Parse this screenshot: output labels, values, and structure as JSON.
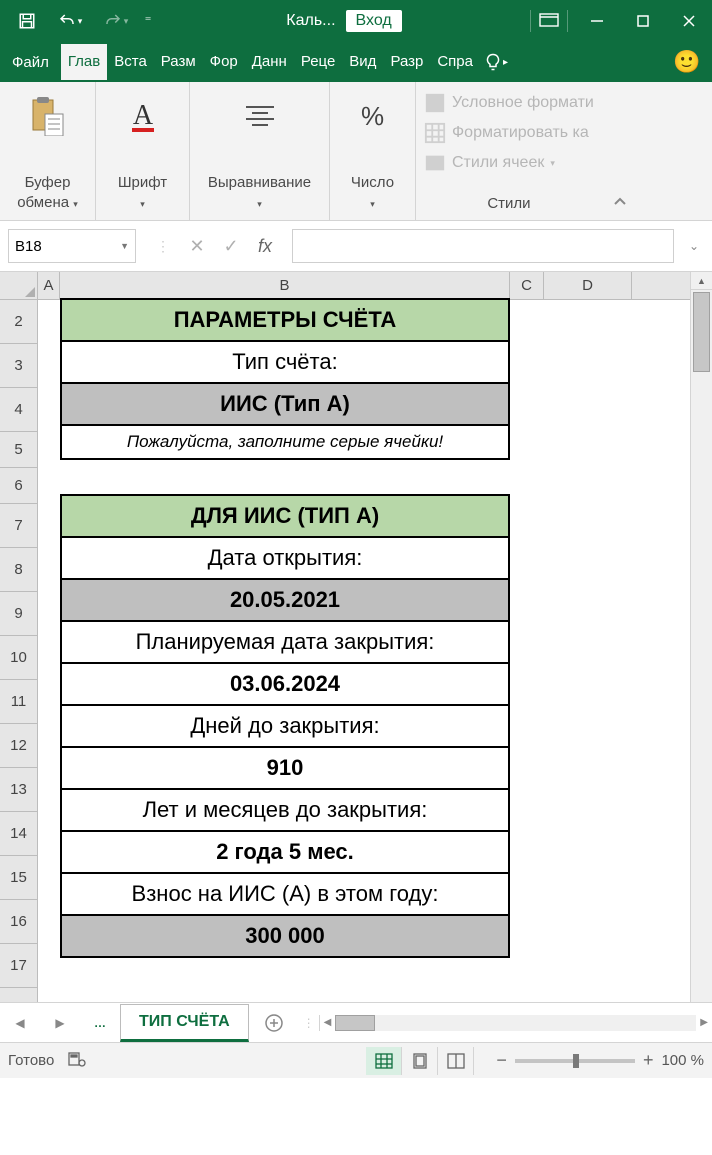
{
  "titlebar": {
    "doc_name": "Каль...",
    "signin": "Вход"
  },
  "tabs": {
    "file": "Файл",
    "items": [
      "Глав",
      "Вста",
      "Разм",
      "Фор",
      "Данн",
      "Реце",
      "Вид",
      "Разр",
      "Спра"
    ]
  },
  "ribbon": {
    "clipboard": "Буфер\nобмена",
    "font": "Шрифт",
    "align": "Выравнивание",
    "number": "Число",
    "pct": "%",
    "cond_format": "Условное формати",
    "format_as": "Форматировать ка",
    "cell_styles": "Стили ячеек",
    "styles_label": "Стили"
  },
  "namebox": "B18",
  "fx": "fx",
  "columns": {
    "A": "A",
    "B": "B",
    "C": "C",
    "D": "D"
  },
  "rows": [
    "2",
    "3",
    "4",
    "5",
    "6",
    "7",
    "8",
    "9",
    "10",
    "11",
    "12",
    "13",
    "14",
    "15",
    "16",
    "17"
  ],
  "cells": {
    "b2": "ПАРАМЕТРЫ СЧЁТА",
    "b3": "Тип счёта:",
    "b4": "ИИС (Тип А)",
    "b5": "Пожалуйста, заполните серые ячейки!",
    "b7": "ДЛЯ ИИС (ТИП А)",
    "b8": "Дата открытия:",
    "b9": "20.05.2021",
    "b10": "Планируемая дата закрытия:",
    "b11": "03.06.2024",
    "b12": "Дней до закрытия:",
    "b13": "910",
    "b14": "Лет и месяцев до закрытия:",
    "b15": "2 года 5 мес.",
    "b16": "Взнос на ИИС (А) в этом году:",
    "b17": "300 000"
  },
  "sheet_tab": "ТИП СЧЁТА",
  "status": {
    "ready": "Готово",
    "zoom": "100 %"
  }
}
